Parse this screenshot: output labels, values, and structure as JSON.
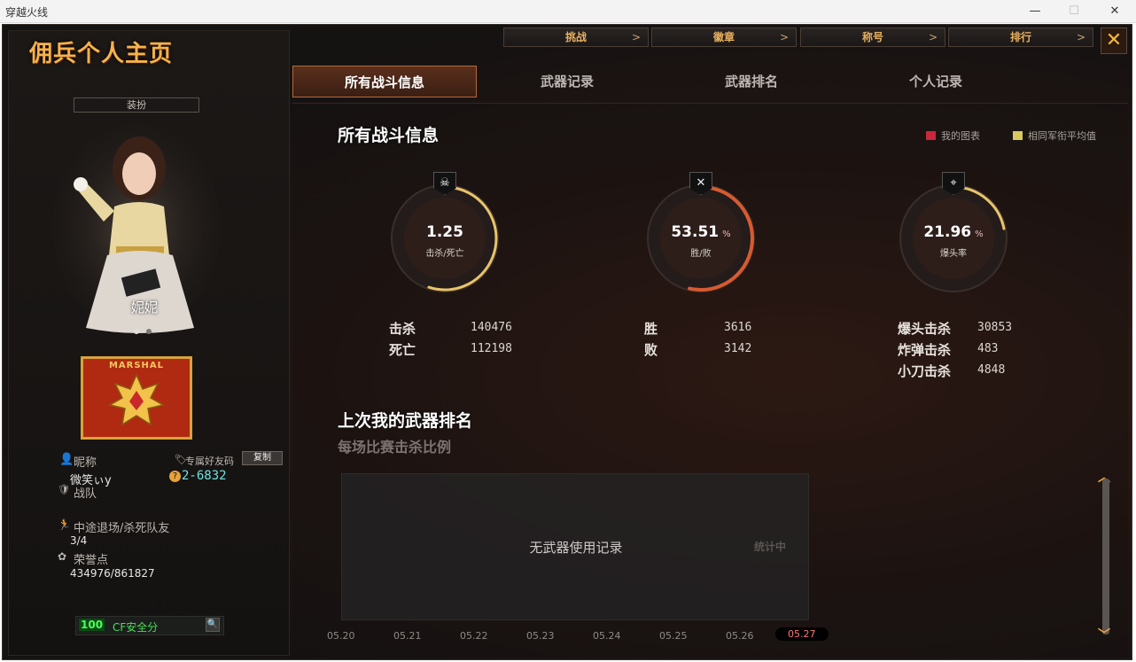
{
  "window": {
    "title": "穿越火线",
    "minimize": "—",
    "maximize": "☐",
    "close": "✕"
  },
  "header": {
    "title": "佣兵个人主页",
    "close_icon": "✕"
  },
  "top_tabs": [
    {
      "label": "挑战",
      "arrow": ">"
    },
    {
      "label": "徽章",
      "arrow": ">"
    },
    {
      "label": "称号",
      "arrow": ">"
    },
    {
      "label": "排行",
      "arrow": ">"
    }
  ],
  "tabs": [
    "所有战斗信息",
    "武器记录",
    "武器排名",
    "个人记录"
  ],
  "profile": {
    "dress_button": "装扮",
    "character_name": "妮妮",
    "rank_label": "MARSHAL",
    "nickname_label": "昵称",
    "nickname_value": "微笑ぃy",
    "friend_code_label": "专属好友码",
    "copy_button": "复制",
    "friend_code_icon": "?",
    "friend_code": "2-6832",
    "team_label": "战队",
    "quit_label": "中途退场/杀死队友",
    "quit_value": "3/4",
    "honor_label": "荣誉点",
    "honor_value": "434976/861827",
    "safety_score": "100",
    "safety_label": "CF安全分",
    "search_icon": "🔍"
  },
  "overview": {
    "title": "所有战斗信息",
    "legend": {
      "mine": "我的图表",
      "average": "相同军衔平均值",
      "mine_color": "#c8283a",
      "average_color": "#d8c860"
    },
    "gauges": [
      {
        "value": "1.25",
        "unit": "",
        "label": "击杀/死亡",
        "icon": "☠",
        "fraction": 0.55
      },
      {
        "value": "53.51",
        "unit": "%",
        "label": "胜/败",
        "icon": "✕",
        "fraction": 0.5351
      },
      {
        "value": "21.96",
        "unit": "%",
        "label": "爆头率",
        "icon": "⌖",
        "fraction": 0.2196
      }
    ],
    "stats": {
      "kills_label": "击杀",
      "kills": "140476",
      "deaths_label": "死亡",
      "deaths": "112198",
      "wins_label": "胜",
      "wins": "3616",
      "losses_label": "败",
      "losses": "3142",
      "headshot_label": "爆头击杀",
      "headshot": "30853",
      "bomb_label": "炸弹击杀",
      "bomb": "483",
      "knife_label": "小刀击杀",
      "knife": "4848"
    }
  },
  "weapons": {
    "title": "上次我的武器排名",
    "subtitle": "每场比赛击杀比例",
    "empty_text": "无武器使用记录",
    "stat_note": "统计中",
    "dates": [
      "05.20",
      "05.21",
      "05.22",
      "05.23",
      "05.24",
      "05.25",
      "05.26",
      "05.27"
    ]
  },
  "icons": {
    "user": "👤",
    "tag": "🏷",
    "team": "🛡",
    "run": "🏃",
    "honor": "✿"
  }
}
